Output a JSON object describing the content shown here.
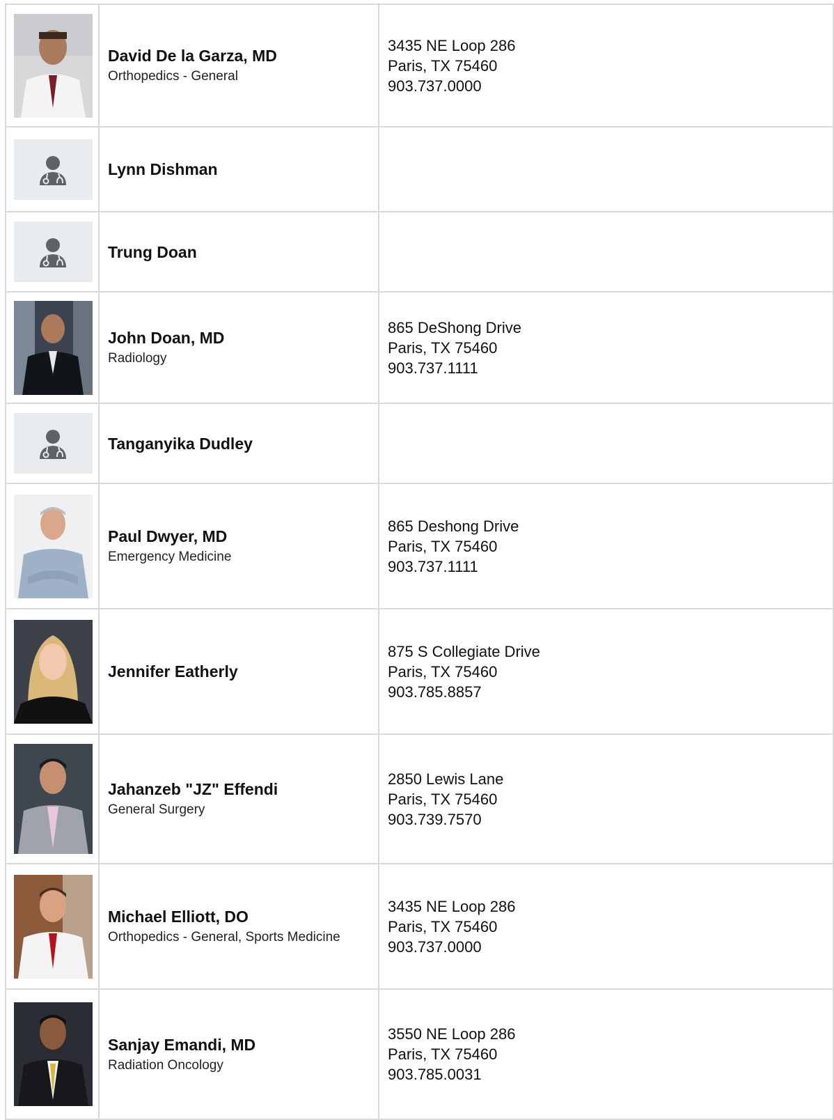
{
  "providers": [
    {
      "name": "David De la Garza, MD",
      "specialty": "Orthopedics - General",
      "address": "3435 NE Loop 286",
      "city": "Paris, TX 75460",
      "phone": "903.737.0000",
      "photo": "portrait-photo"
    },
    {
      "name": "Lynn Dishman",
      "specialty": "",
      "address": "",
      "city": "",
      "phone": "",
      "photo": "doctor-placeholder-icon"
    },
    {
      "name": "Trung Doan",
      "specialty": "",
      "address": "",
      "city": "",
      "phone": "",
      "photo": "doctor-placeholder-icon"
    },
    {
      "name": "John Doan, MD",
      "specialty": "Radiology",
      "address": "865 DeShong Drive",
      "city": "Paris, TX 75460",
      "phone": "903.737.1111",
      "photo": "portrait-photo"
    },
    {
      "name": "Tanganyika Dudley",
      "specialty": "",
      "address": "",
      "city": "",
      "phone": "",
      "photo": "doctor-placeholder-icon"
    },
    {
      "name": "Paul Dwyer, MD",
      "specialty": "Emergency Medicine",
      "address": "865 Deshong Drive",
      "city": "Paris, TX 75460",
      "phone": "903.737.1111",
      "photo": "portrait-photo"
    },
    {
      "name": "Jennifer Eatherly",
      "specialty": "",
      "address": "875 S Collegiate Drive",
      "city": "Paris, TX 75460",
      "phone": "903.785.8857",
      "photo": "portrait-photo"
    },
    {
      "name": "Jahanzeb \"JZ\" Effendi",
      "specialty": "General Surgery",
      "address": "2850 Lewis Lane",
      "city": "Paris, TX 75460",
      "phone": "903.739.7570",
      "photo": "portrait-photo"
    },
    {
      "name": "Michael Elliott, DO",
      "specialty": "Orthopedics - General, Sports Medicine",
      "address": "3435 NE Loop 286",
      "city": "Paris, TX 75460",
      "phone": "903.737.0000",
      "photo": "portrait-photo"
    },
    {
      "name": "Sanjay Emandi, MD",
      "specialty": "Radiation Oncology",
      "address": "3550 NE Loop 286",
      "city": "Paris, TX 75460",
      "phone": "903.785.0031",
      "photo": "portrait-photo"
    }
  ],
  "colors": {
    "border": "#d9d9d9",
    "placeholder_bg": "#e9ecef",
    "placeholder_icon": "#5f6368"
  }
}
